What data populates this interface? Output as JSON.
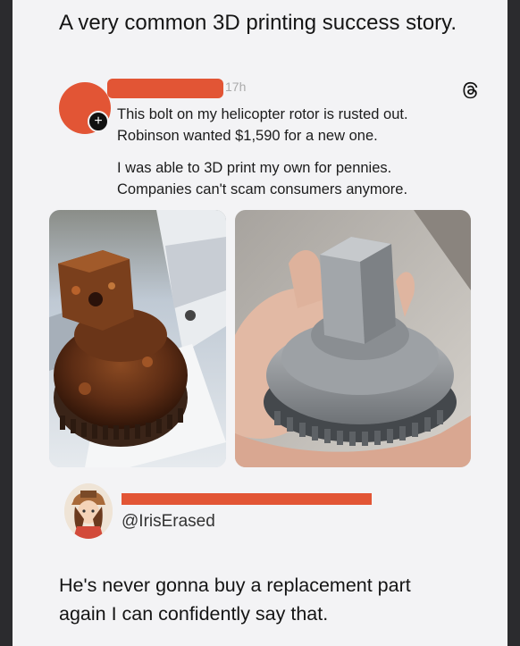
{
  "headline": "A very common 3D printing success story.",
  "threads_post": {
    "time": "17h",
    "line1": "This bolt on my helicopter rotor is rusted out.",
    "line2": "Robinson wanted $1,590 for a new one.",
    "line3": "I was able to 3D print my own for pennies.",
    "line4": "Companies can't scam consumers anymore.",
    "redaction_color": "#e25535",
    "icon": "threads-icon"
  },
  "tweet": {
    "handle": "@IrisErased",
    "text_line1": "He's never gonna buy a replacement part",
    "text_line2": "again I can confidently say that."
  }
}
